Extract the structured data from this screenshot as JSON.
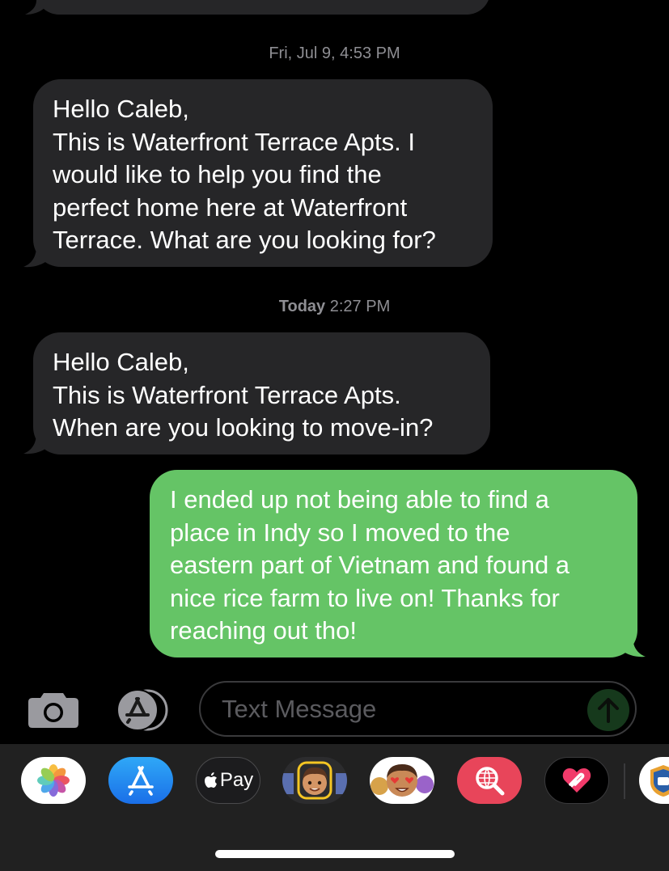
{
  "thread": {
    "timestamp_1": {
      "day": "Fri, Jul 9,",
      "time": "4:53 PM"
    },
    "message_1": {
      "lines": [
        "Hello Caleb,",
        "This is Waterfront Terrace Apts. I",
        "would like to help you find the",
        "perfect home here at Waterfront",
        "Terrace. What are you looking for?"
      ]
    },
    "timestamp_2": {
      "day": "Today",
      "time": "2:27 PM"
    },
    "message_2": {
      "lines": [
        "Hello Caleb,",
        "This is Waterfront Terrace Apts.",
        "When are you looking to move-in?"
      ]
    },
    "message_3": {
      "lines": [
        "I ended up not being able to find a",
        "place in Indy so I moved to the",
        "eastern part of Vietnam and found a",
        "nice rice farm to live on! Thanks for",
        "reaching out tho!"
      ]
    }
  },
  "composer": {
    "placeholder": "Text Message",
    "icons": [
      "camera-icon",
      "app-store-icon",
      "send-arrow-icon"
    ]
  },
  "app_tray": {
    "apps": [
      {
        "name": "photos-icon"
      },
      {
        "name": "app-store-icon"
      },
      {
        "name": "apple-pay-icon",
        "label": "Pay"
      },
      {
        "name": "memoji-sticker-icon"
      },
      {
        "name": "animoji-icon"
      },
      {
        "name": "web-search-icon"
      },
      {
        "name": "digital-touch-icon"
      },
      {
        "name": "partial-app-icon"
      }
    ]
  },
  "colors": {
    "background": "#000000",
    "incoming_bubble": "#262628",
    "outgoing_bubble": "#65c466",
    "timestamp": "#8e8e93",
    "tray": "#212121"
  }
}
